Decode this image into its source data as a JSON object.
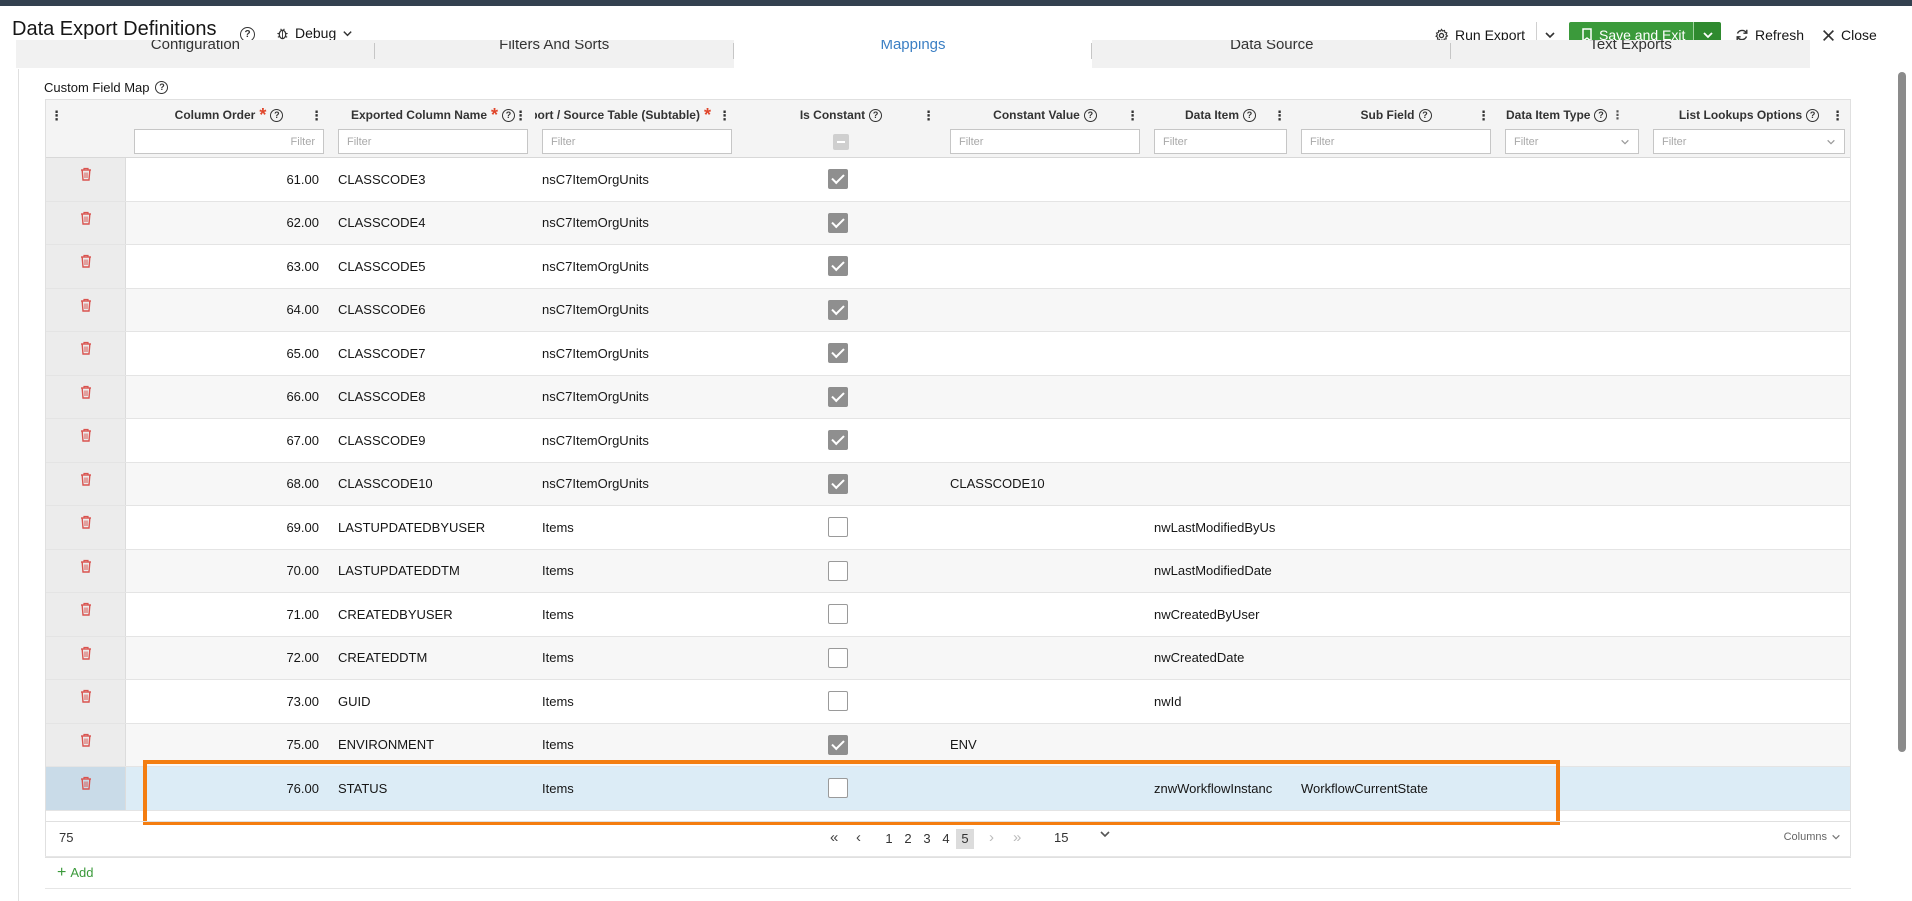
{
  "header": {
    "title": "Data Export Definitions",
    "debug_label": "Debug",
    "run_export_label": "Run Export",
    "save_exit_label": "Save and Exit",
    "refresh_label": "Refresh",
    "close_label": "Close"
  },
  "tabs": [
    {
      "label": "Configuration"
    },
    {
      "label": "Filters And Sorts"
    },
    {
      "label": "Mappings",
      "active": true
    },
    {
      "label": "Data Source"
    },
    {
      "label": "Text Exports"
    }
  ],
  "section": {
    "title": "Custom Field Map"
  },
  "columns": {
    "order": "Column Order",
    "exported": "Exported Column Name",
    "source": "port / Source Table (Subtable)",
    "constant": "Is Constant",
    "constant_value": "Constant Value",
    "data_item": "Data Item",
    "sub_field": "Sub Field",
    "data_item_type": "Data Item Type",
    "list_lookups": "List Lookups Options"
  },
  "filter_placeholder": "Filter",
  "rows": [
    {
      "order": "61.00",
      "name": "CLASSCODE3",
      "source": "nsC7ItemOrgUnits",
      "constant": true,
      "value": "",
      "item": "",
      "sub": ""
    },
    {
      "order": "62.00",
      "name": "CLASSCODE4",
      "source": "nsC7ItemOrgUnits",
      "constant": true,
      "value": "",
      "item": "",
      "sub": ""
    },
    {
      "order": "63.00",
      "name": "CLASSCODE5",
      "source": "nsC7ItemOrgUnits",
      "constant": true,
      "value": "",
      "item": "",
      "sub": ""
    },
    {
      "order": "64.00",
      "name": "CLASSCODE6",
      "source": "nsC7ItemOrgUnits",
      "constant": true,
      "value": "",
      "item": "",
      "sub": ""
    },
    {
      "order": "65.00",
      "name": "CLASSCODE7",
      "source": "nsC7ItemOrgUnits",
      "constant": true,
      "value": "",
      "item": "",
      "sub": ""
    },
    {
      "order": "66.00",
      "name": "CLASSCODE8",
      "source": "nsC7ItemOrgUnits",
      "constant": true,
      "value": "",
      "item": "",
      "sub": ""
    },
    {
      "order": "67.00",
      "name": "CLASSCODE9",
      "source": "nsC7ItemOrgUnits",
      "constant": true,
      "value": "",
      "item": "",
      "sub": ""
    },
    {
      "order": "68.00",
      "name": "CLASSCODE10",
      "source": "nsC7ItemOrgUnits",
      "constant": true,
      "value": "CLASSCODE10",
      "item": "",
      "sub": ""
    },
    {
      "order": "69.00",
      "name": "LASTUPDATEDBYUSER",
      "source": "Items",
      "constant": false,
      "value": "",
      "item": "nwLastModifiedByUs",
      "sub": ""
    },
    {
      "order": "70.00",
      "name": "LASTUPDATEDDTM",
      "source": "Items",
      "constant": false,
      "value": "",
      "item": "nwLastModifiedDate",
      "sub": ""
    },
    {
      "order": "71.00",
      "name": "CREATEDBYUSER",
      "source": "Items",
      "constant": false,
      "value": "",
      "item": "nwCreatedByUser",
      "sub": ""
    },
    {
      "order": "72.00",
      "name": "CREATEDDTM",
      "source": "Items",
      "constant": false,
      "value": "",
      "item": "nwCreatedDate",
      "sub": ""
    },
    {
      "order": "73.00",
      "name": "GUID",
      "source": "Items",
      "constant": false,
      "value": "",
      "item": "nwId",
      "sub": ""
    },
    {
      "order": "75.00",
      "name": "ENVIRONMENT",
      "source": "Items",
      "constant": true,
      "value": "ENV",
      "item": "",
      "sub": ""
    },
    {
      "order": "76.00",
      "name": "STATUS",
      "source": "Items",
      "constant": false,
      "value": "",
      "item": "znwWorkflowInstanc",
      "sub": "WorkflowCurrentState",
      "selected": true
    }
  ],
  "pager": {
    "count": "75",
    "pages": [
      "1",
      "2",
      "3",
      "4",
      "5"
    ],
    "current_page": "5",
    "page_size": "15",
    "columns_label": "Columns"
  },
  "add_label": "Add",
  "colors": {
    "accent": "#3b7fc4",
    "save": "#3b9a3b",
    "highlight": "#f47d10",
    "delete": "#d9534f",
    "selected_row": "#dcecf6"
  }
}
